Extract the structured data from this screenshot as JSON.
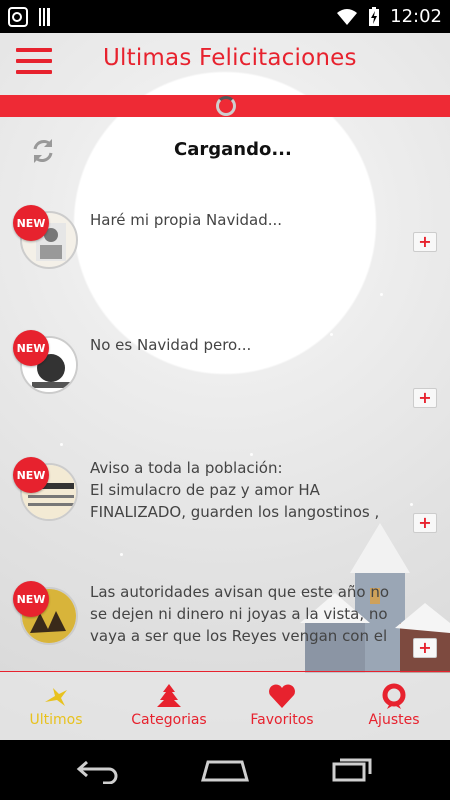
{
  "status_bar": {
    "time": "12:02"
  },
  "header": {
    "title": "Ultimas Felicitaciones"
  },
  "loading": {
    "text": "Cargando..."
  },
  "items": [
    {
      "badge": "NEW",
      "text": "Haré mi propia Navidad..."
    },
    {
      "badge": "NEW",
      "text": "No es Navidad pero..."
    },
    {
      "badge": "NEW",
      "text": "Aviso a toda la población:\nEl simulacro de paz y amor HA FINALIZADO, guarden los langostinos ,"
    },
    {
      "badge": "NEW",
      "text": "Las autoridades avisan que este año no se dejen ni dinero ni joyas a la vista, no vaya a ser que los Reyes vengan con el"
    }
  ],
  "tabs": [
    {
      "label": "Ultimos",
      "icon": "star-icon",
      "color": "#e8c21e"
    },
    {
      "label": "Categorias",
      "icon": "tree-icon",
      "color": "#e7222e"
    },
    {
      "label": "Favoritos",
      "icon": "heart-icon",
      "color": "#e7222e"
    },
    {
      "label": "Ajustes",
      "icon": "wreath-icon",
      "color": "#e7222e"
    }
  ],
  "colors": {
    "accent": "#e7222e",
    "active_tab": "#e8c21e"
  }
}
